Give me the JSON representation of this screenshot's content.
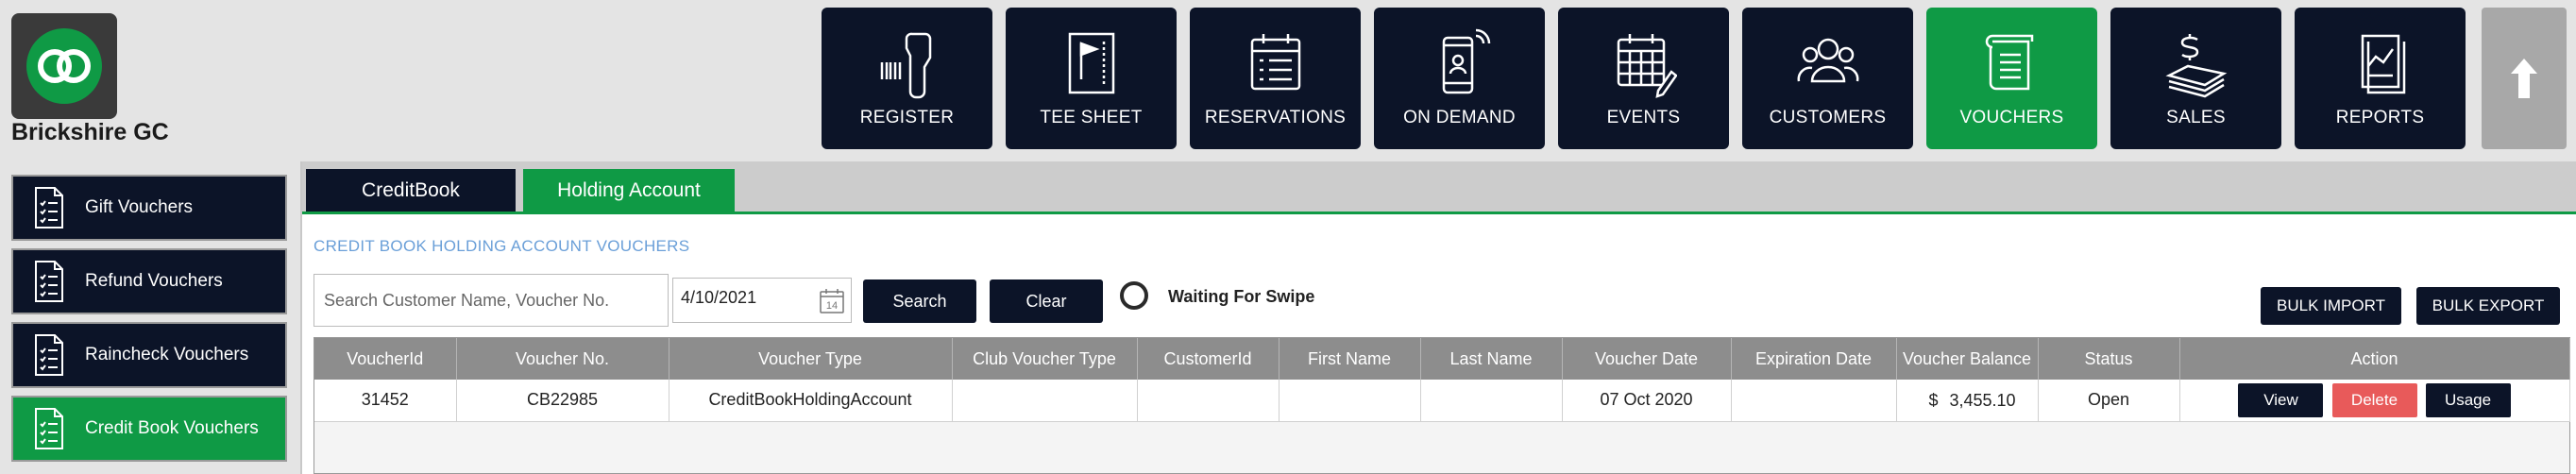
{
  "app": {
    "club_name": "Brickshire GC"
  },
  "nav": [
    {
      "label": "REGISTER",
      "icon": "barcode-scanner-icon",
      "active": false
    },
    {
      "label": "TEE SHEET",
      "icon": "flag-icon",
      "active": false
    },
    {
      "label": "RESERVATIONS",
      "icon": "reservation-list-icon",
      "active": false
    },
    {
      "label": "ON DEMAND",
      "icon": "mobile-phone-icon",
      "active": false
    },
    {
      "label": "EVENTS",
      "icon": "calendar-edit-icon",
      "active": false
    },
    {
      "label": "CUSTOMERS",
      "icon": "users-icon",
      "active": false
    },
    {
      "label": "VOUCHERS",
      "icon": "voucher-document-icon",
      "active": true
    },
    {
      "label": "SALES",
      "icon": "money-stack-icon",
      "active": false
    },
    {
      "label": "REPORTS",
      "icon": "report-chart-icon",
      "active": false
    }
  ],
  "scroll_top_icon": "arrow-up-icon",
  "sidebar": {
    "items": [
      {
        "label": "Gift Vouchers",
        "active": false
      },
      {
        "label": "Refund Vouchers",
        "active": false
      },
      {
        "label": "Raincheck Vouchers",
        "active": false
      },
      {
        "label": "Credit Book Vouchers",
        "active": true
      }
    ]
  },
  "tabs": [
    {
      "label": "CreditBook",
      "active": false
    },
    {
      "label": "Holding Account",
      "active": true
    }
  ],
  "section_title": "CREDIT BOOK HOLDING ACCOUNT VOUCHERS",
  "filters": {
    "search_placeholder": "Search Customer Name, Voucher No.",
    "date_value": "4/10/2021",
    "search_label": "Search",
    "clear_label": "Clear",
    "swipe_status": "Waiting For Swipe",
    "bulk_import_label": "BULK IMPORT",
    "bulk_export_label": "BULK EXPORT"
  },
  "table": {
    "headers": [
      "VoucherId",
      "Voucher No.",
      "Voucher Type",
      "Club Voucher Type",
      "CustomerId",
      "First Name",
      "Last Name",
      "Voucher Date",
      "Expiration Date",
      "Voucher Balance",
      "Status",
      "Action"
    ],
    "rows": [
      {
        "voucher_id": "31452",
        "voucher_no": "CB22985",
        "voucher_type": "CreditBookHoldingAccount",
        "club_voucher_type": "",
        "customer_id": "",
        "first_name": "",
        "last_name": "",
        "voucher_date": "07 Oct 2020",
        "expiration_date": "",
        "balance_symbol": "$",
        "balance_amount": "3,455.10",
        "status": "Open",
        "actions": {
          "view": "View",
          "delete": "Delete",
          "usage": "Usage"
        }
      }
    ]
  },
  "colors": {
    "dark_navy": "#0c1428",
    "brand_green": "#0f9a45",
    "delete_red": "#e85a5a",
    "link_blue": "#6a9fd8",
    "header_grey": "#8d8d8d"
  }
}
